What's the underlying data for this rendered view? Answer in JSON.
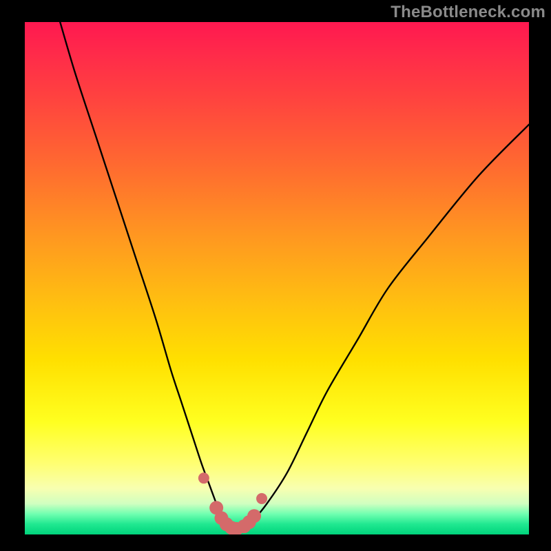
{
  "watermark": "TheBottleneck.com",
  "colors": {
    "curve_stroke": "#000000",
    "marker_fill": "#d46a6a",
    "marker_stroke": "#b85050"
  },
  "chart_data": {
    "type": "line",
    "title": "",
    "xlabel": "",
    "ylabel": "",
    "xlim": [
      0,
      100
    ],
    "ylim": [
      0,
      100
    ],
    "series": [
      {
        "name": "bottleneck-curve",
        "x": [
          7,
          10,
          14,
          18,
          22,
          26,
          29,
          31,
          33,
          35,
          36.5,
          38,
          39,
          40,
          41,
          42,
          43,
          45,
          48,
          52,
          56,
          60,
          66,
          72,
          80,
          90,
          100
        ],
        "values": [
          100,
          90,
          78,
          66,
          54,
          42,
          32,
          26,
          20,
          14,
          10,
          6,
          3.5,
          2,
          1.2,
          1,
          1.2,
          2.5,
          6,
          12,
          20,
          28,
          38,
          48,
          58,
          70,
          80
        ]
      }
    ],
    "markers": {
      "name": "highlight-points",
      "x": [
        35.5,
        38,
        39,
        40,
        41,
        42,
        43.5,
        44.5,
        45.5,
        47
      ],
      "values": [
        11,
        5.2,
        3.2,
        2,
        1.3,
        1.1,
        1.6,
        2.4,
        3.6,
        7
      ]
    }
  }
}
